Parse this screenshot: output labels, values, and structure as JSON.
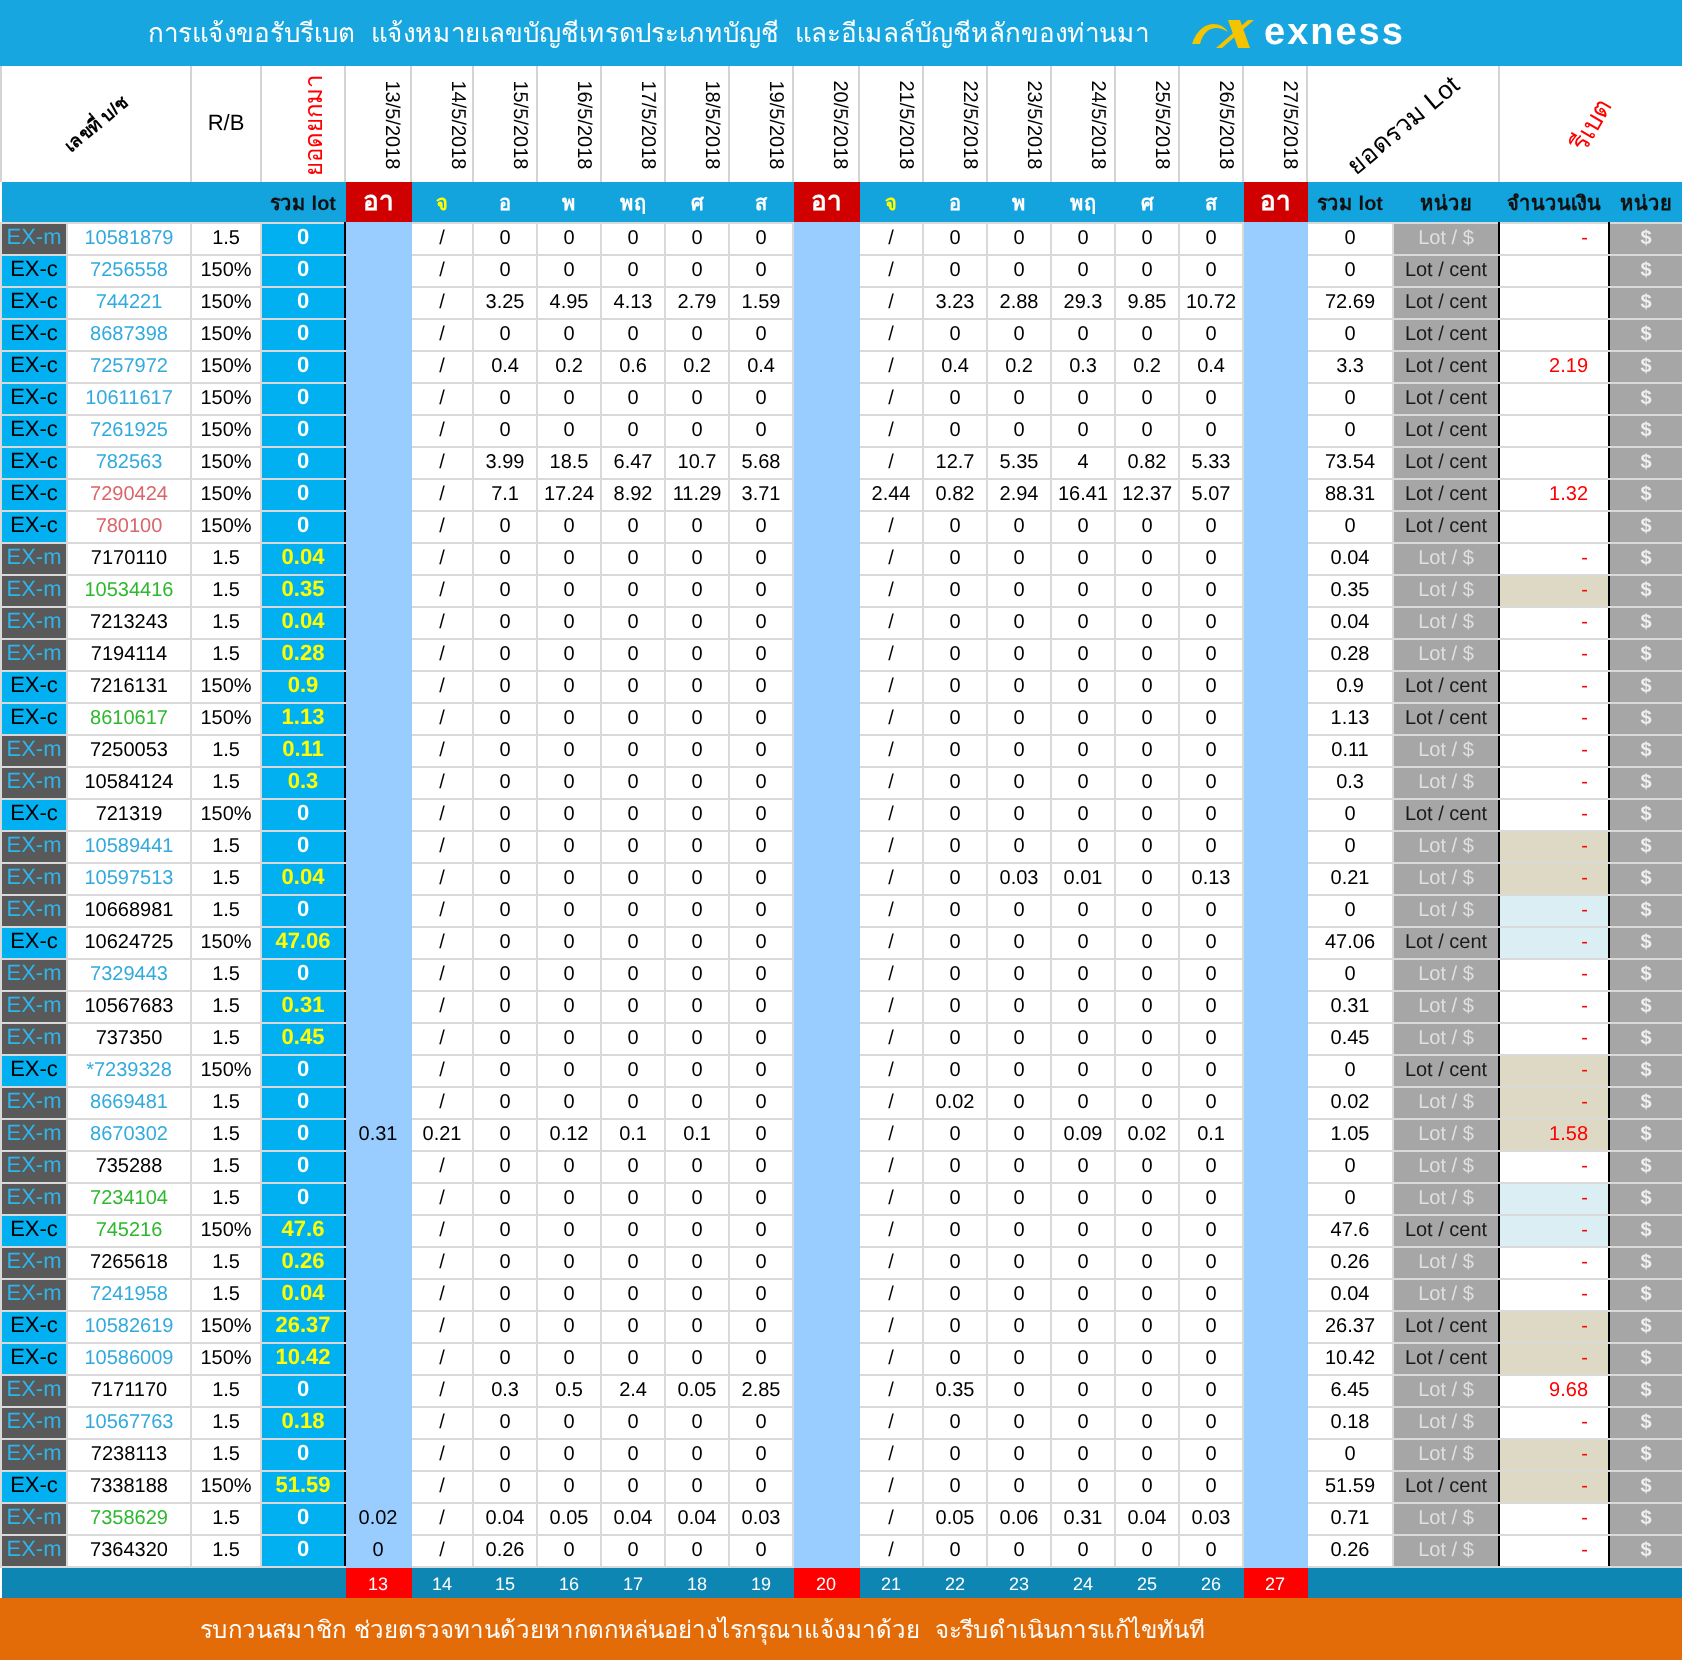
{
  "title_bar": {
    "text": "การแจ้งขอรับรีเบต  แจ้งหมายเลขบัญชีเทรดประเภทบัญชี  และอีเมลล์บัญชีหลักของท่านมา",
    "logo": "exness"
  },
  "table": {
    "header": {
      "account": "เลขที่ บ/ช",
      "rb": "R/B",
      "carried": "ยอดยกมา",
      "dates": [
        "13/5/2018",
        "14/5/2018",
        "15/5/2018",
        "16/5/2018",
        "17/5/2018",
        "18/5/2018",
        "19/5/2018",
        "20/5/2018",
        "21/5/2018",
        "22/5/2018",
        "23/5/2018",
        "24/5/2018",
        "25/5/2018",
        "26/5/2018",
        "27/5/2018"
      ],
      "total": "ยอดรวม Lot",
      "rebate": "รีเบต"
    },
    "subheader": {
      "carried": "รวม lot",
      "day_names": [
        {
          "text": "อา",
          "kind": "sun"
        },
        {
          "text": "จ",
          "kind": "mon"
        },
        {
          "text": "อ",
          "kind": "day"
        },
        {
          "text": "พ",
          "kind": "day"
        },
        {
          "text": "พฤ",
          "kind": "day"
        },
        {
          "text": "ศ",
          "kind": "day"
        },
        {
          "text": "ส",
          "kind": "day"
        },
        {
          "text": "อา",
          "kind": "sun"
        },
        {
          "text": "จ",
          "kind": "mon"
        },
        {
          "text": "อ",
          "kind": "day"
        },
        {
          "text": "พ",
          "kind": "day"
        },
        {
          "text": "พฤ",
          "kind": "day"
        },
        {
          "text": "ศ",
          "kind": "day"
        },
        {
          "text": "ส",
          "kind": "day"
        },
        {
          "text": "อา",
          "kind": "sun"
        }
      ],
      "total": "รวม lot",
      "unit": "หน่วย",
      "amount": "จำนวนเงิน",
      "unit2": "หน่วย"
    },
    "rows": [
      {
        "kind": "m",
        "type": "EX-m",
        "account": {
          "text": "10581879",
          "color": "#33aadd"
        },
        "rb": "1.5",
        "carried": "0",
        "carried_lit": false,
        "days": {
          "day_2": "/",
          "day_3": "0",
          "day_4": "0",
          "day_5": "0",
          "day_6": "0",
          "day_7": "0",
          "day_9": "/",
          "day_10": "0",
          "day_11": "0",
          "day_12": "0",
          "day_13": "0",
          "day_14": "0"
        },
        "total": "0",
        "unit": "Lot / $",
        "amount": {
          "text": "-"
        },
        "currency": "$"
      },
      {
        "kind": "c",
        "type": "EX-c",
        "account": {
          "text": "7256558",
          "color": "#33aadd"
        },
        "rb": "150%",
        "carried": "0",
        "carried_lit": false,
        "days": {
          "day_2": "/",
          "day_3": "0",
          "day_4": "0",
          "day_5": "0",
          "day_6": "0",
          "day_7": "0",
          "day_9": "/",
          "day_10": "0",
          "day_11": "0",
          "day_12": "0",
          "day_13": "0",
          "day_14": "0"
        },
        "total": "0",
        "unit": "Lot / cent",
        "currency": "$"
      },
      {
        "kind": "c",
        "type": "EX-c",
        "account": {
          "text": "744221",
          "color": "#33aadd"
        },
        "rb": "150%",
        "carried": "0",
        "carried_lit": false,
        "days": {
          "day_2": "/",
          "day_3": "3.25",
          "day_4": "4.95",
          "day_5": "4.13",
          "day_6": "2.79",
          "day_7": "1.59",
          "day_9": "/",
          "day_10": "3.23",
          "day_11": "2.88",
          "day_12": "29.3",
          "day_13": "9.85",
          "day_14": "10.72"
        },
        "total": "72.69",
        "unit": "Lot / cent",
        "currency": "$"
      },
      {
        "kind": "c",
        "type": "EX-c",
        "account": {
          "text": "8687398",
          "color": "#33aadd"
        },
        "rb": "150%",
        "carried": "0",
        "carried_lit": false,
        "days": {
          "day_2": "/",
          "day_3": "0",
          "day_4": "0",
          "day_5": "0",
          "day_6": "0",
          "day_7": "0",
          "day_9": "/",
          "day_10": "0",
          "day_11": "0",
          "day_12": "0",
          "day_13": "0",
          "day_14": "0"
        },
        "total": "0",
        "unit": "Lot / cent",
        "currency": "$"
      },
      {
        "kind": "c",
        "type": "EX-c",
        "account": {
          "text": "7257972",
          "color": "#33aadd"
        },
        "rb": "150%",
        "carried": "0",
        "carried_lit": false,
        "days": {
          "day_2": "/",
          "day_3": "0.4",
          "day_4": "0.2",
          "day_5": "0.6",
          "day_6": "0.2",
          "day_7": "0.4",
          "day_9": "/",
          "day_10": "0.4",
          "day_11": "0.2",
          "day_12": "0.3",
          "day_13": "0.2",
          "day_14": "0.4"
        },
        "total": "3.3",
        "unit": "Lot / cent",
        "amount": {
          "text": "2.19"
        },
        "currency": "$"
      },
      {
        "kind": "c",
        "type": "EX-c",
        "account": {
          "text": "10611617",
          "color": "#33aadd"
        },
        "rb": "150%",
        "carried": "0",
        "carried_lit": false,
        "days": {
          "day_2": "/",
          "day_3": "0",
          "day_4": "0",
          "day_5": "0",
          "day_6": "0",
          "day_7": "0",
          "day_9": "/",
          "day_10": "0",
          "day_11": "0",
          "day_12": "0",
          "day_13": "0",
          "day_14": "0"
        },
        "total": "0",
        "unit": "Lot / cent",
        "currency": "$"
      },
      {
        "kind": "c",
        "type": "EX-c",
        "account": {
          "text": "7261925",
          "color": "#33aadd"
        },
        "rb": "150%",
        "carried": "0",
        "carried_lit": false,
        "days": {
          "day_2": "/",
          "day_3": "0",
          "day_4": "0",
          "day_5": "0",
          "day_6": "0",
          "day_7": "0",
          "day_9": "/",
          "day_10": "0",
          "day_11": "0",
          "day_12": "0",
          "day_13": "0",
          "day_14": "0"
        },
        "total": "0",
        "unit": "Lot / cent",
        "currency": "$"
      },
      {
        "kind": "c",
        "type": "EX-c",
        "account": {
          "text": "782563",
          "color": "#33aadd"
        },
        "rb": "150%",
        "carried": "0",
        "carried_lit": false,
        "days": {
          "day_2": "/",
          "day_3": "3.99",
          "day_4": "18.5",
          "day_5": "6.47",
          "day_6": "10.7",
          "day_7": "5.68",
          "day_9": "/",
          "day_10": "12.7",
          "day_11": "5.35",
          "day_12": "4",
          "day_13": "0.82",
          "day_14": "5.33"
        },
        "total": "73.54",
        "unit": "Lot / cent",
        "currency": "$"
      },
      {
        "kind": "c",
        "type": "EX-c",
        "account": {
          "text": "7290424",
          "color": "#d9666a"
        },
        "rb": "150%",
        "carried": "0",
        "carried_lit": false,
        "days": {
          "day_2": "/",
          "day_3": "7.1",
          "day_4": "17.24",
          "day_5": "8.92",
          "day_6": "11.29",
          "day_7": "3.71",
          "day_9": "2.44",
          "day_10": "0.82",
          "day_11": "2.94",
          "day_12": "16.41",
          "day_13": "12.37",
          "day_14": "5.07"
        },
        "total": "88.31",
        "unit": "Lot / cent",
        "amount": {
          "text": "1.32"
        },
        "currency": "$"
      },
      {
        "kind": "c",
        "type": "EX-c",
        "account": {
          "text": "780100",
          "color": "#d9666a"
        },
        "rb": "150%",
        "carried": "0",
        "carried_lit": false,
        "days": {
          "day_2": "/",
          "day_3": "0",
          "day_4": "0",
          "day_5": "0",
          "day_6": "0",
          "day_7": "0",
          "day_9": "/",
          "day_10": "0",
          "day_11": "0",
          "day_12": "0",
          "day_13": "0",
          "day_14": "0"
        },
        "total": "0",
        "unit": "Lot / cent",
        "currency": "$"
      },
      {
        "kind": "m",
        "type": "EX-m",
        "account": {
          "text": "7170110",
          "color": "#000000"
        },
        "rb": "1.5",
        "carried": "0.04",
        "carried_lit": true,
        "days": {
          "day_2": "/",
          "day_3": "0",
          "day_4": "0",
          "day_5": "0",
          "day_6": "0",
          "day_7": "0",
          "day_9": "/",
          "day_10": "0",
          "day_11": "0",
          "day_12": "0",
          "day_13": "0",
          "day_14": "0"
        },
        "total": "0.04",
        "unit": "Lot / $",
        "amount": {
          "text": "-"
        },
        "currency": "$"
      },
      {
        "kind": "m",
        "type": "EX-m",
        "account": {
          "text": "10534416",
          "color": "#2eb82e"
        },
        "rb": "1.5",
        "carried": "0.35",
        "carried_lit": true,
        "days": {
          "day_2": "/",
          "day_3": "0",
          "day_4": "0",
          "day_5": "0",
          "day_6": "0",
          "day_7": "0",
          "day_9": "/",
          "day_10": "0",
          "day_11": "0",
          "day_12": "0",
          "day_13": "0",
          "day_14": "0"
        },
        "total": "0.35",
        "unit": "Lot / $",
        "amount": {
          "text": "-",
          "color": "#ddd9c4"
        },
        "currency": "$"
      },
      {
        "kind": "m",
        "type": "EX-m",
        "account": {
          "text": "7213243",
          "color": "#000000"
        },
        "rb": "1.5",
        "carried": "0.04",
        "carried_lit": true,
        "days": {
          "day_2": "/",
          "day_3": "0",
          "day_4": "0",
          "day_5": "0",
          "day_6": "0",
          "day_7": "0",
          "day_9": "/",
          "day_10": "0",
          "day_11": "0",
          "day_12": "0",
          "day_13": "0",
          "day_14": "0"
        },
        "total": "0.04",
        "unit": "Lot / $",
        "amount": {
          "text": "-"
        },
        "currency": "$"
      },
      {
        "kind": "m",
        "type": "EX-m",
        "account": {
          "text": "7194114",
          "color": "#000000"
        },
        "rb": "1.5",
        "carried": "0.28",
        "carried_lit": true,
        "days": {
          "day_2": "/",
          "day_3": "0",
          "day_4": "0",
          "day_5": "0",
          "day_6": "0",
          "day_7": "0",
          "day_9": "/",
          "day_10": "0",
          "day_11": "0",
          "day_12": "0",
          "day_13": "0",
          "day_14": "0"
        },
        "total": "0.28",
        "unit": "Lot / $",
        "amount": {
          "text": "-"
        },
        "currency": "$"
      },
      {
        "kind": "c",
        "type": "EX-c",
        "account": {
          "text": "7216131",
          "color": "#000000"
        },
        "rb": "150%",
        "carried": "0.9",
        "carried_lit": true,
        "days": {
          "day_2": "/",
          "day_3": "0",
          "day_4": "0",
          "day_5": "0",
          "day_6": "0",
          "day_7": "0",
          "day_9": "/",
          "day_10": "0",
          "day_11": "0",
          "day_12": "0",
          "day_13": "0",
          "day_14": "0"
        },
        "total": "0.9",
        "unit": "Lot / cent",
        "amount": {
          "text": "-"
        },
        "currency": "$"
      },
      {
        "kind": "c",
        "type": "EX-c",
        "account": {
          "text": "8610617",
          "color": "#2eb82e"
        },
        "rb": "150%",
        "carried": "1.13",
        "carried_lit": true,
        "days": {
          "day_2": "/",
          "day_3": "0",
          "day_4": "0",
          "day_5": "0",
          "day_6": "0",
          "day_7": "0",
          "day_9": "/",
          "day_10": "0",
          "day_11": "0",
          "day_12": "0",
          "day_13": "0",
          "day_14": "0"
        },
        "total": "1.13",
        "unit": "Lot / cent",
        "amount": {
          "text": "-"
        },
        "currency": "$"
      },
      {
        "kind": "m",
        "type": "EX-m",
        "account": {
          "text": "7250053",
          "color": "#000000"
        },
        "rb": "1.5",
        "carried": "0.11",
        "carried_lit": true,
        "days": {
          "day_2": "/",
          "day_3": "0",
          "day_4": "0",
          "day_5": "0",
          "day_6": "0",
          "day_7": "0",
          "day_9": "/",
          "day_10": "0",
          "day_11": "0",
          "day_12": "0",
          "day_13": "0",
          "day_14": "0"
        },
        "total": "0.11",
        "unit": "Lot / $",
        "amount": {
          "text": "-"
        },
        "currency": "$"
      },
      {
        "kind": "m",
        "type": "EX-m",
        "account": {
          "text": "10584124",
          "color": "#000000"
        },
        "rb": "1.5",
        "carried": "0.3",
        "carried_lit": true,
        "days": {
          "day_2": "/",
          "day_3": "0",
          "day_4": "0",
          "day_5": "0",
          "day_6": "0",
          "day_7": "0",
          "day_9": "/",
          "day_10": "0",
          "day_11": "0",
          "day_12": "0",
          "day_13": "0",
          "day_14": "0"
        },
        "total": "0.3",
        "unit": "Lot / $",
        "amount": {
          "text": "-"
        },
        "currency": "$"
      },
      {
        "kind": "c",
        "type": "EX-c",
        "account": {
          "text": "721319",
          "color": "#000000"
        },
        "rb": "150%",
        "carried": "0",
        "carried_lit": false,
        "days": {
          "day_2": "/",
          "day_3": "0",
          "day_4": "0",
          "day_5": "0",
          "day_6": "0",
          "day_7": "0",
          "day_9": "/",
          "day_10": "0",
          "day_11": "0",
          "day_12": "0",
          "day_13": "0",
          "day_14": "0"
        },
        "total": "0",
        "unit": "Lot / cent",
        "amount": {
          "text": "-"
        },
        "currency": "$"
      },
      {
        "kind": "m",
        "type": "EX-m",
        "account": {
          "text": "10589441",
          "color": "#33aadd"
        },
        "rb": "1.5",
        "carried": "0",
        "carried_lit": false,
        "days": {
          "day_2": "/",
          "day_3": "0",
          "day_4": "0",
          "day_5": "0",
          "day_6": "0",
          "day_7": "0",
          "day_9": "/",
          "day_10": "0",
          "day_11": "0",
          "day_12": "0",
          "day_13": "0",
          "day_14": "0"
        },
        "total": "0",
        "unit": "Lot / $",
        "amount": {
          "text": "-",
          "color": "#ddd9c4"
        },
        "currency": "$"
      },
      {
        "kind": "m",
        "type": "EX-m",
        "account": {
          "text": "10597513",
          "color": "#33aadd"
        },
        "rb": "1.5",
        "carried": "0.04",
        "carried_lit": true,
        "days": {
          "day_2": "/",
          "day_3": "0",
          "day_4": "0",
          "day_5": "0",
          "day_6": "0",
          "day_7": "0",
          "day_9": "/",
          "day_10": "0",
          "day_11": "0.03",
          "day_12": "0.01",
          "day_13": "0",
          "day_14": "0.13"
        },
        "total": "0.21",
        "unit": "Lot / $",
        "amount": {
          "text": "-",
          "color": "#ddd9c4"
        },
        "currency": "$"
      },
      {
        "kind": "m",
        "type": "EX-m",
        "account": {
          "text": "10668981",
          "color": "#000000"
        },
        "rb": "1.5",
        "carried": "0",
        "carried_lit": false,
        "days": {
          "day_2": "/",
          "day_3": "0",
          "day_4": "0",
          "day_5": "0",
          "day_6": "0",
          "day_7": "0",
          "day_9": "/",
          "day_10": "0",
          "day_11": "0",
          "day_12": "0",
          "day_13": "0",
          "day_14": "0"
        },
        "total": "0",
        "unit": "Lot / $",
        "amount": {
          "text": "-",
          "color": "#daeef3"
        },
        "currency": "$"
      },
      {
        "kind": "c",
        "type": "EX-c",
        "account": {
          "text": "10624725",
          "color": "#000000"
        },
        "rb": "150%",
        "carried": "47.06",
        "carried_lit": true,
        "days": {
          "day_2": "/",
          "day_3": "0",
          "day_4": "0",
          "day_5": "0",
          "day_6": "0",
          "day_7": "0",
          "day_9": "/",
          "day_10": "0",
          "day_11": "0",
          "day_12": "0",
          "day_13": "0",
          "day_14": "0"
        },
        "total": "47.06",
        "unit": "Lot / cent",
        "amount": {
          "text": "-",
          "color": "#daeef3"
        },
        "currency": "$"
      },
      {
        "kind": "m",
        "type": "EX-m",
        "account": {
          "text": "7329443",
          "color": "#33aadd"
        },
        "rb": "1.5",
        "carried": "0",
        "carried_lit": false,
        "days": {
          "day_2": "/",
          "day_3": "0",
          "day_4": "0",
          "day_5": "0",
          "day_6": "0",
          "day_7": "0",
          "day_9": "/",
          "day_10": "0",
          "day_11": "0",
          "day_12": "0",
          "day_13": "0",
          "day_14": "0"
        },
        "total": "0",
        "unit": "Lot / $",
        "amount": {
          "text": "-"
        },
        "currency": "$"
      },
      {
        "kind": "m",
        "type": "EX-m",
        "account": {
          "text": "10567683",
          "color": "#000000"
        },
        "rb": "1.5",
        "carried": "0.31",
        "carried_lit": true,
        "days": {
          "day_2": "/",
          "day_3": "0",
          "day_4": "0",
          "day_5": "0",
          "day_6": "0",
          "day_7": "0",
          "day_9": "/",
          "day_10": "0",
          "day_11": "0",
          "day_12": "0",
          "day_13": "0",
          "day_14": "0"
        },
        "total": "0.31",
        "unit": "Lot / $",
        "amount": {
          "text": "-"
        },
        "currency": "$"
      },
      {
        "kind": "m",
        "type": "EX-m",
        "account": {
          "text": "737350",
          "color": "#000000"
        },
        "rb": "1.5",
        "carried": "0.45",
        "carried_lit": true,
        "days": {
          "day_2": "/",
          "day_3": "0",
          "day_4": "0",
          "day_5": "0",
          "day_6": "0",
          "day_7": "0",
          "day_9": "/",
          "day_10": "0",
          "day_11": "0",
          "day_12": "0",
          "day_13": "0",
          "day_14": "0"
        },
        "total": "0.45",
        "unit": "Lot / $",
        "amount": {
          "text": "-"
        },
        "currency": "$"
      },
      {
        "kind": "c",
        "type": "EX-c",
        "account": {
          "text": "*7239328",
          "color": "#33aadd"
        },
        "rb": "150%",
        "carried": "0",
        "carried_lit": false,
        "days": {
          "day_2": "/",
          "day_3": "0",
          "day_4": "0",
          "day_5": "0",
          "day_6": "0",
          "day_7": "0",
          "day_9": "/",
          "day_10": "0",
          "day_11": "0",
          "day_12": "0",
          "day_13": "0",
          "day_14": "0"
        },
        "total": "0",
        "unit": "Lot / cent",
        "amount": {
          "text": "-",
          "color": "#ddd9c4"
        },
        "currency": "$"
      },
      {
        "kind": "m",
        "type": "EX-m",
        "account": {
          "text": "8669481",
          "color": "#33aadd"
        },
        "rb": "1.5",
        "carried": "0",
        "carried_lit": false,
        "days": {
          "day_2": "/",
          "day_3": "0",
          "day_4": "0",
          "day_5": "0",
          "day_6": "0",
          "day_7": "0",
          "day_9": "/",
          "day_10": "0.02",
          "day_11": "0",
          "day_12": "0",
          "day_13": "0",
          "day_14": "0"
        },
        "total": "0.02",
        "unit": "Lot / $",
        "amount": {
          "text": "-",
          "color": "#ddd9c4"
        },
        "currency": "$"
      },
      {
        "kind": "m",
        "type": "EX-m",
        "account": {
          "text": "8670302",
          "color": "#33aadd"
        },
        "rb": "1.5",
        "carried": "0",
        "carried_lit": false,
        "days": {
          "day_1": "0.31",
          "day_2": "0.21",
          "day_3": "0",
          "day_4": "0.12",
          "day_5": "0.1",
          "day_6": "0.1",
          "day_7": "0",
          "day_9": "/",
          "day_10": "0",
          "day_11": "0",
          "day_12": "0.09",
          "day_13": "0.02",
          "day_14": "0.1"
        },
        "total": "1.05",
        "unit": "Lot / $",
        "amount": {
          "text": "1.58",
          "color": "#ddd9c4"
        },
        "currency": "$"
      },
      {
        "kind": "m",
        "type": "EX-m",
        "account": {
          "text": "735288",
          "color": "#000000"
        },
        "rb": "1.5",
        "carried": "0",
        "carried_lit": false,
        "days": {
          "day_2": "/",
          "day_3": "0",
          "day_4": "0",
          "day_5": "0",
          "day_6": "0",
          "day_7": "0",
          "day_9": "/",
          "day_10": "0",
          "day_11": "0",
          "day_12": "0",
          "day_13": "0",
          "day_14": "0"
        },
        "total": "0",
        "unit": "Lot / $",
        "amount": {
          "text": "-"
        },
        "currency": "$"
      },
      {
        "kind": "m",
        "type": "EX-m",
        "account": {
          "text": "7234104",
          "color": "#2eb82e"
        },
        "rb": "1.5",
        "carried": "0",
        "carried_lit": false,
        "days": {
          "day_2": "/",
          "day_3": "0",
          "day_4": "0",
          "day_5": "0",
          "day_6": "0",
          "day_7": "0",
          "day_9": "/",
          "day_10": "0",
          "day_11": "0",
          "day_12": "0",
          "day_13": "0",
          "day_14": "0"
        },
        "total": "0",
        "unit": "Lot / $",
        "amount": {
          "text": "-",
          "color": "#daeef3"
        },
        "currency": "$"
      },
      {
        "kind": "c",
        "type": "EX-c",
        "account": {
          "text": "745216",
          "color": "#2eb82e"
        },
        "rb": "150%",
        "carried": "47.6",
        "carried_lit": true,
        "days": {
          "day_2": "/",
          "day_3": "0",
          "day_4": "0",
          "day_5": "0",
          "day_6": "0",
          "day_7": "0",
          "day_9": "/",
          "day_10": "0",
          "day_11": "0",
          "day_12": "0",
          "day_13": "0",
          "day_14": "0"
        },
        "total": "47.6",
        "unit": "Lot / cent",
        "amount": {
          "text": "-",
          "color": "#daeef3"
        },
        "currency": "$"
      },
      {
        "kind": "m",
        "type": "EX-m",
        "account": {
          "text": "7265618",
          "color": "#000000"
        },
        "rb": "1.5",
        "carried": "0.26",
        "carried_lit": true,
        "days": {
          "day_2": "/",
          "day_3": "0",
          "day_4": "0",
          "day_5": "0",
          "day_6": "0",
          "day_7": "0",
          "day_9": "/",
          "day_10": "0",
          "day_11": "0",
          "day_12": "0",
          "day_13": "0",
          "day_14": "0"
        },
        "total": "0.26",
        "unit": "Lot / $",
        "amount": {
          "text": "-"
        },
        "currency": "$"
      },
      {
        "kind": "m",
        "type": "EX-m",
        "account": {
          "text": "7241958",
          "color": "#33aadd"
        },
        "rb": "1.5",
        "carried": "0.04",
        "carried_lit": true,
        "days": {
          "day_2": "/",
          "day_3": "0",
          "day_4": "0",
          "day_5": "0",
          "day_6": "0",
          "day_7": "0",
          "day_9": "/",
          "day_10": "0",
          "day_11": "0",
          "day_12": "0",
          "day_13": "0",
          "day_14": "0"
        },
        "total": "0.04",
        "unit": "Lot / $",
        "amount": {
          "text": "-"
        },
        "currency": "$"
      },
      {
        "kind": "c",
        "type": "EX-c",
        "account": {
          "text": "10582619",
          "color": "#33aadd"
        },
        "rb": "150%",
        "carried": "26.37",
        "carried_lit": true,
        "days": {
          "day_2": "/",
          "day_3": "0",
          "day_4": "0",
          "day_5": "0",
          "day_6": "0",
          "day_7": "0",
          "day_9": "/",
          "day_10": "0",
          "day_11": "0",
          "day_12": "0",
          "day_13": "0",
          "day_14": "0"
        },
        "total": "26.37",
        "unit": "Lot / cent",
        "amount": {
          "text": "-",
          "color": "#ddd9c4"
        },
        "currency": "$"
      },
      {
        "kind": "c",
        "type": "EX-c",
        "account": {
          "text": "10586009",
          "color": "#33aadd"
        },
        "rb": "150%",
        "carried": "10.42",
        "carried_lit": true,
        "days": {
          "day_2": "/",
          "day_3": "0",
          "day_4": "0",
          "day_5": "0",
          "day_6": "0",
          "day_7": "0",
          "day_9": "/",
          "day_10": "0",
          "day_11": "0",
          "day_12": "0",
          "day_13": "0",
          "day_14": "0"
        },
        "total": "10.42",
        "unit": "Lot / cent",
        "amount": {
          "text": "-",
          "color": "#ddd9c4"
        },
        "currency": "$"
      },
      {
        "kind": "m",
        "type": "EX-m",
        "account": {
          "text": "7171170",
          "color": "#000000"
        },
        "rb": "1.5",
        "carried": "0",
        "carried_lit": false,
        "days": {
          "day_2": "/",
          "day_3": "0.3",
          "day_4": "0.5",
          "day_5": "2.4",
          "day_6": "0.05",
          "day_7": "2.85",
          "day_9": "/",
          "day_10": "0.35",
          "day_11": "0",
          "day_12": "0",
          "day_13": "0",
          "day_14": "0"
        },
        "total": "6.45",
        "unit": "Lot / $",
        "amount": {
          "text": "9.68"
        },
        "currency": "$"
      },
      {
        "kind": "m",
        "type": "EX-m",
        "account": {
          "text": "10567763",
          "color": "#33aadd"
        },
        "rb": "1.5",
        "carried": "0.18",
        "carried_lit": true,
        "days": {
          "day_2": "/",
          "day_3": "0",
          "day_4": "0",
          "day_5": "0",
          "day_6": "0",
          "day_7": "0",
          "day_9": "/",
          "day_10": "0",
          "day_11": "0",
          "day_12": "0",
          "day_13": "0",
          "day_14": "0"
        },
        "total": "0.18",
        "unit": "Lot / $",
        "amount": {
          "text": "-"
        },
        "currency": "$"
      },
      {
        "kind": "m",
        "type": "EX-m",
        "account": {
          "text": "7238113",
          "color": "#000000"
        },
        "rb": "1.5",
        "carried": "0",
        "carried_lit": false,
        "days": {
          "day_2": "/",
          "day_3": "0",
          "day_4": "0",
          "day_5": "0",
          "day_6": "0",
          "day_7": "0",
          "day_9": "/",
          "day_10": "0",
          "day_11": "0",
          "day_12": "0",
          "day_13": "0",
          "day_14": "0"
        },
        "total": "0",
        "unit": "Lot / $",
        "amount": {
          "text": "-",
          "color": "#ddd9c4"
        },
        "currency": "$"
      },
      {
        "kind": "c",
        "type": "EX-c",
        "account": {
          "text": "7338188",
          "color": "#000000"
        },
        "rb": "150%",
        "carried": "51.59",
        "carried_lit": true,
        "days": {
          "day_2": "/",
          "day_3": "0",
          "day_4": "0",
          "day_5": "0",
          "day_6": "0",
          "day_7": "0",
          "day_9": "/",
          "day_10": "0",
          "day_11": "0",
          "day_12": "0",
          "day_13": "0",
          "day_14": "0"
        },
        "total": "51.59",
        "unit": "Lot / cent",
        "amount": {
          "text": "-",
          "color": "#ddd9c4"
        },
        "currency": "$"
      },
      {
        "kind": "m",
        "type": "EX-m",
        "account": {
          "text": "7358629",
          "color": "#2eb82e"
        },
        "rb": "1.5",
        "carried": "0",
        "carried_lit": false,
        "days": {
          "day_1": "0.02",
          "day_2": "/",
          "day_3": "0.04",
          "day_4": "0.05",
          "day_5": "0.04",
          "day_6": "0.04",
          "day_7": "0.03",
          "day_9": "/",
          "day_10": "0.05",
          "day_11": "0.06",
          "day_12": "0.31",
          "day_13": "0.04",
          "day_14": "0.03"
        },
        "total": "0.71",
        "unit": "Lot / $",
        "amount": {
          "text": "-"
        },
        "currency": "$"
      },
      {
        "kind": "m",
        "type": "EX-m",
        "account": {
          "text": "7364320",
          "color": "#000000"
        },
        "rb": "1.5",
        "carried": "0",
        "carried_lit": false,
        "days": {
          "day_1": "0",
          "day_2": "/",
          "day_3": "0.26",
          "day_4": "0",
          "day_5": "0",
          "day_6": "0",
          "day_7": "0",
          "day_9": "/",
          "day_10": "0",
          "day_11": "0",
          "day_12": "0",
          "day_13": "0",
          "day_14": "0"
        },
        "total": "0.26",
        "unit": "Lot / $",
        "amount": {
          "text": "-"
        },
        "currency": "$"
      }
    ],
    "day_numbers": [
      {
        "text": "13",
        "kind": "sun"
      },
      {
        "text": "14",
        "kind": "day"
      },
      {
        "text": "15",
        "kind": "day"
      },
      {
        "text": "16",
        "kind": "day"
      },
      {
        "text": "17",
        "kind": "day"
      },
      {
        "text": "18",
        "kind": "day"
      },
      {
        "text": "19",
        "kind": "day"
      },
      {
        "text": "20",
        "kind": "sun"
      },
      {
        "text": "21",
        "kind": "day"
      },
      {
        "text": "22",
        "kind": "day"
      },
      {
        "text": "23",
        "kind": "day"
      },
      {
        "text": "24",
        "kind": "day"
      },
      {
        "text": "25",
        "kind": "day"
      },
      {
        "text": "26",
        "kind": "day"
      },
      {
        "text": "27",
        "kind": "sun"
      }
    ]
  },
  "footer": {
    "text": "รบกวนสมาชิก ช่วยตรวจทานด้วยหากตกหล่นอย่างไรกรุณาแจ้งมาด้วย  จะรีบดำเนินการแก้ไขทันที"
  }
}
